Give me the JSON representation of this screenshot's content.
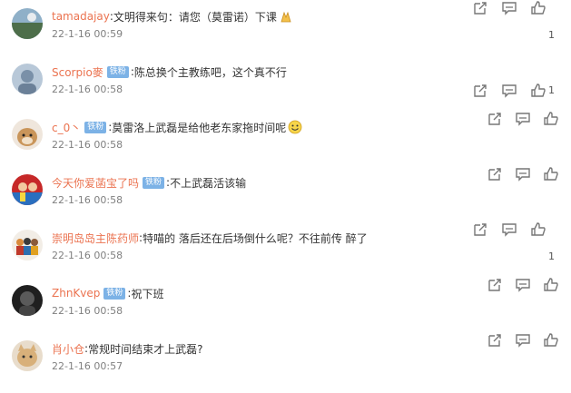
{
  "comments": [
    {
      "user": "tamadajay",
      "badge": "",
      "sep": ":",
      "text": "文明得来句：请您（莫雷诺）下课",
      "emoji": "pray-hands-emoji",
      "time": "22-1-16 00:59",
      "likes": "1",
      "avatar_color": "#5a7a5a"
    },
    {
      "user": "Scorpio麥",
      "badge": "铁粉",
      "sep": ":",
      "text": "陈总换个主教练吧，这个真不行",
      "emoji": "",
      "time": "22-1-16 00:58",
      "likes": "1",
      "avatar_color": "#8aa0b8"
    },
    {
      "user": "c_0丶",
      "badge": "铁粉",
      "sep": ":",
      "text": "莫雷洛上武磊是给他老东家拖时间呢",
      "emoji": "grin-face-emoji",
      "time": "22-1-16 00:58",
      "likes": "",
      "avatar_color": "#c8a070"
    },
    {
      "user": "今天你爱菡宝了吗",
      "badge": "铁粉",
      "sep": ":",
      "text": "不上武磊活该输",
      "emoji": "",
      "time": "22-1-16 00:58",
      "likes": "",
      "avatar_color": "#c03030"
    },
    {
      "user": "崇明岛岛主陈药师",
      "badge": "",
      "sep": ":",
      "text": "特喵的 落后还在后场倒什么呢？不往前传  醉了",
      "emoji": "",
      "time": "22-1-16 00:58",
      "likes": "1",
      "avatar_color": "#d07030"
    },
    {
      "user": "ZhnKvep",
      "badge": "铁粉",
      "sep": ":",
      "text": "祝下班",
      "emoji": "",
      "time": "22-1-16 00:58",
      "likes": "",
      "avatar_color": "#303030"
    },
    {
      "user": "肖小仓",
      "badge": "",
      "sep": ":",
      "text": "常规时间结束才上武磊?",
      "emoji": "",
      "time": "22-1-16 00:57",
      "likes": "",
      "avatar_color": "#d0b080"
    }
  ],
  "icons": {
    "share": "share-icon",
    "comment": "comment-icon",
    "like": "thumbs-up-icon"
  },
  "colors": {
    "username": "#eb7350",
    "badge_bg": "#7cb2e6",
    "time": "#808080",
    "icon": "#777777"
  }
}
